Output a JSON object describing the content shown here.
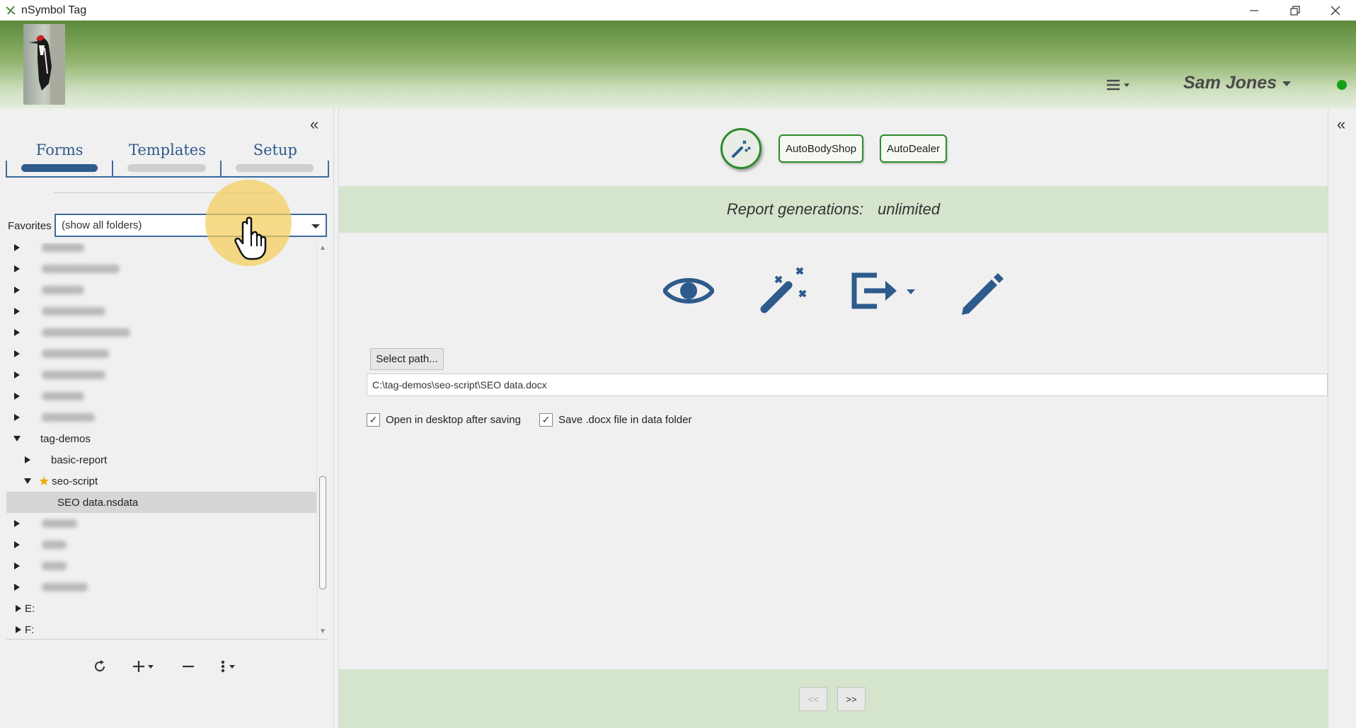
{
  "window": {
    "title": "nSymbol Tag"
  },
  "header": {
    "user_name": "Sam Jones",
    "status": "online"
  },
  "left": {
    "collapse_label": "«",
    "tabs": [
      {
        "label": "Forms",
        "active": true
      },
      {
        "label": "Templates",
        "active": false
      },
      {
        "label": "Setup",
        "active": false
      }
    ],
    "favorites_label": "Favorites",
    "favorites_value": "(show all folders)",
    "tree": {
      "tag_demos": "tag-demos",
      "basic_report": "basic-report",
      "seo_script": "seo-script",
      "seo_data": "SEO data.nsdata",
      "drive_e": "E:",
      "drive_f": "F:"
    }
  },
  "center": {
    "buttons": [
      {
        "label": "AutoBodyShop"
      },
      {
        "label": "AutoDealer"
      }
    ],
    "report_label": "Report generations:",
    "report_value": "unlimited",
    "select_path_label": "Select path...",
    "path_value": "C:\\tag-demos\\seo-script\\SEO data.docx",
    "checkboxes": [
      {
        "label": "Open in desktop after saving",
        "checked": true
      },
      {
        "label": "Save .docx file in data folder",
        "checked": true
      }
    ],
    "prev_label": "<<",
    "next_label": ">>"
  },
  "right": {
    "collapse_label": "«"
  },
  "colors": {
    "accent_blue": "#2e5a8c",
    "accent_green": "#2d8a2d",
    "band_green": "#d5e4cc",
    "status_green": "#17a017"
  }
}
